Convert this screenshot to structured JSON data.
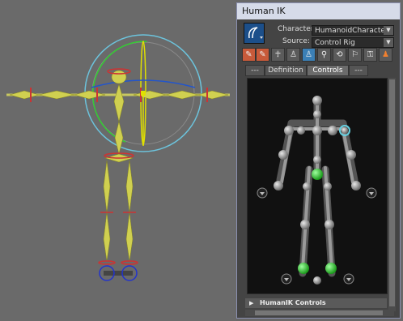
{
  "window": {
    "title": "Human IK"
  },
  "character": {
    "label": "Character:",
    "value": "HumanoidCharacter"
  },
  "source": {
    "label": "Source:",
    "value": "Control Rig"
  },
  "tabs": [
    {
      "label": "---"
    },
    {
      "label": "Definition"
    },
    {
      "label": "Controls",
      "active": true
    },
    {
      "label": "---"
    }
  ],
  "toolbar": {
    "icons": [
      "pencil-icon",
      "pencil-red-icon",
      "body-full-icon",
      "body-ik-icon",
      "body-fk-icon",
      "pin-translate-icon",
      "pin-rotate-icon",
      "pin-none-icon",
      "key-all-icon",
      "orange-figure-icon"
    ]
  },
  "section": {
    "label": "HumanIK Controls"
  },
  "colors": {
    "titlebar": "#d6dbe9",
    "panel_bg": "#444444",
    "viewport_bg": "#6a6a6a",
    "joint_gray": "#9a9a9a",
    "joint_green": "#3ecc3e",
    "selected": "#66d0e0"
  }
}
